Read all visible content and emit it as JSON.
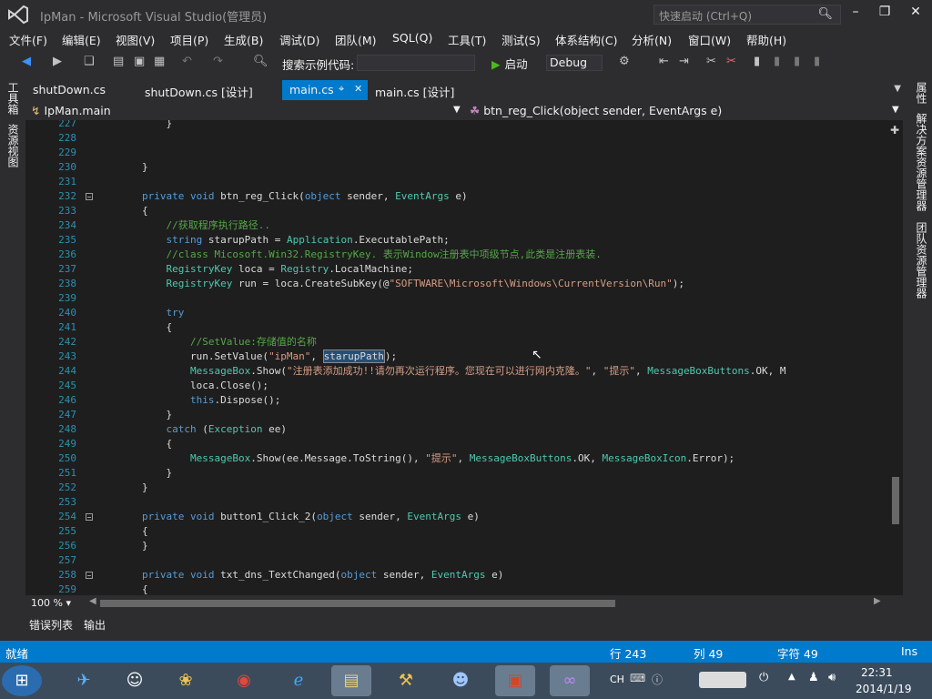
{
  "app": {
    "title": "IpMan - Microsoft Visual Studio(管理员)",
    "quick_launch_placeholder": "快速启动 (Ctrl+Q)"
  },
  "menu": [
    "文件(F)",
    "编辑(E)",
    "视图(V)",
    "项目(P)",
    "生成(B)",
    "调试(D)",
    "团队(M)",
    "SQL(Q)",
    "工具(T)",
    "测试(S)",
    "体系结构(C)",
    "分析(N)",
    "窗口(W)",
    "帮助(H)"
  ],
  "toolbar": {
    "search_label": "搜索示例代码:",
    "start_label": "启动",
    "config": "Debug"
  },
  "left_strip": [
    "工具箱",
    "资源视图"
  ],
  "right_strip": [
    "属性",
    "解决方案资源管理器",
    "团队资源管理器"
  ],
  "tabs": [
    {
      "label": "shutDown.cs",
      "active": false
    },
    {
      "label": "shutDown.cs [设计]",
      "active": false
    },
    {
      "label": "main.cs",
      "active": true
    },
    {
      "label": "main.cs [设计]",
      "active": false
    }
  ],
  "nav": {
    "class": "IpMan.main",
    "member": "btn_reg_Click(object sender, EventArgs e)"
  },
  "code": [
    {
      "n": "227",
      "text": "            }"
    },
    {
      "n": "228",
      "text": ""
    },
    {
      "n": "229",
      "text": ""
    },
    {
      "n": "230",
      "text": "        }"
    },
    {
      "n": "231",
      "text": ""
    },
    {
      "n": "232",
      "text": "        private void btn_reg_Click(object sender, EventArgs e)"
    },
    {
      "n": "233",
      "text": "        {"
    },
    {
      "n": "234",
      "text": "            //获取程序执行路径.."
    },
    {
      "n": "235",
      "text": "            string starupPath = Application.ExecutablePath;"
    },
    {
      "n": "236",
      "text": "            //class Micosoft.Win32.RegistryKey. 表示Window注册表中项级节点,此类是注册表装."
    },
    {
      "n": "237",
      "text": "            RegistryKey loca = Registry.LocalMachine;"
    },
    {
      "n": "238",
      "text": "            RegistryKey run = loca.CreateSubKey(@\"SOFTWARE\\Microsoft\\Windows\\CurrentVersion\\Run\");"
    },
    {
      "n": "239",
      "text": ""
    },
    {
      "n": "240",
      "text": "            try"
    },
    {
      "n": "241",
      "text": "            {"
    },
    {
      "n": "242",
      "text": "                //SetValue:存储值的名称"
    },
    {
      "n": "243",
      "text": "                run.SetValue(\"ipMan\", starupPath);"
    },
    {
      "n": "244",
      "text": "                MessageBox.Show(\"注册表添加成功!!请勿再次运行程序。您现在可以进行网内克隆。\", \"提示\", MessageBoxButtons.OK, M"
    },
    {
      "n": "245",
      "text": "                loca.Close();"
    },
    {
      "n": "246",
      "text": "                this.Dispose();"
    },
    {
      "n": "247",
      "text": "            }"
    },
    {
      "n": "248",
      "text": "            catch (Exception ee)"
    },
    {
      "n": "249",
      "text": "            {"
    },
    {
      "n": "250",
      "text": "                MessageBox.Show(ee.Message.ToString(), \"提示\", MessageBoxButtons.OK, MessageBoxIcon.Error);"
    },
    {
      "n": "251",
      "text": "            }"
    },
    {
      "n": "252",
      "text": "        }"
    },
    {
      "n": "253",
      "text": ""
    },
    {
      "n": "254",
      "text": "        private void button1_Click_2(object sender, EventArgs e)"
    },
    {
      "n": "255",
      "text": "        {"
    },
    {
      "n": "256",
      "text": "        }"
    },
    {
      "n": "257",
      "text": ""
    },
    {
      "n": "258",
      "text": "        private void txt_dns_TextChanged(object sender, EventArgs e)"
    },
    {
      "n": "259",
      "text": "        {"
    }
  ],
  "zoom": "100 %",
  "bottom_tabs": [
    "错误列表",
    "输出"
  ],
  "status": {
    "ready": "就绪",
    "line": "行 243",
    "col": "列 49",
    "char": "字符 49",
    "mode": "Ins"
  },
  "taskbar": {
    "ime": "CH",
    "time": "22:31",
    "date": "2014/1/19"
  },
  "colors": {
    "accent": "#007acc",
    "editor_bg": "#1e1e1e",
    "keyword": "#569cd6",
    "type": "#4ec9b0",
    "comment": "#57a64a",
    "string": "#d69d85"
  }
}
